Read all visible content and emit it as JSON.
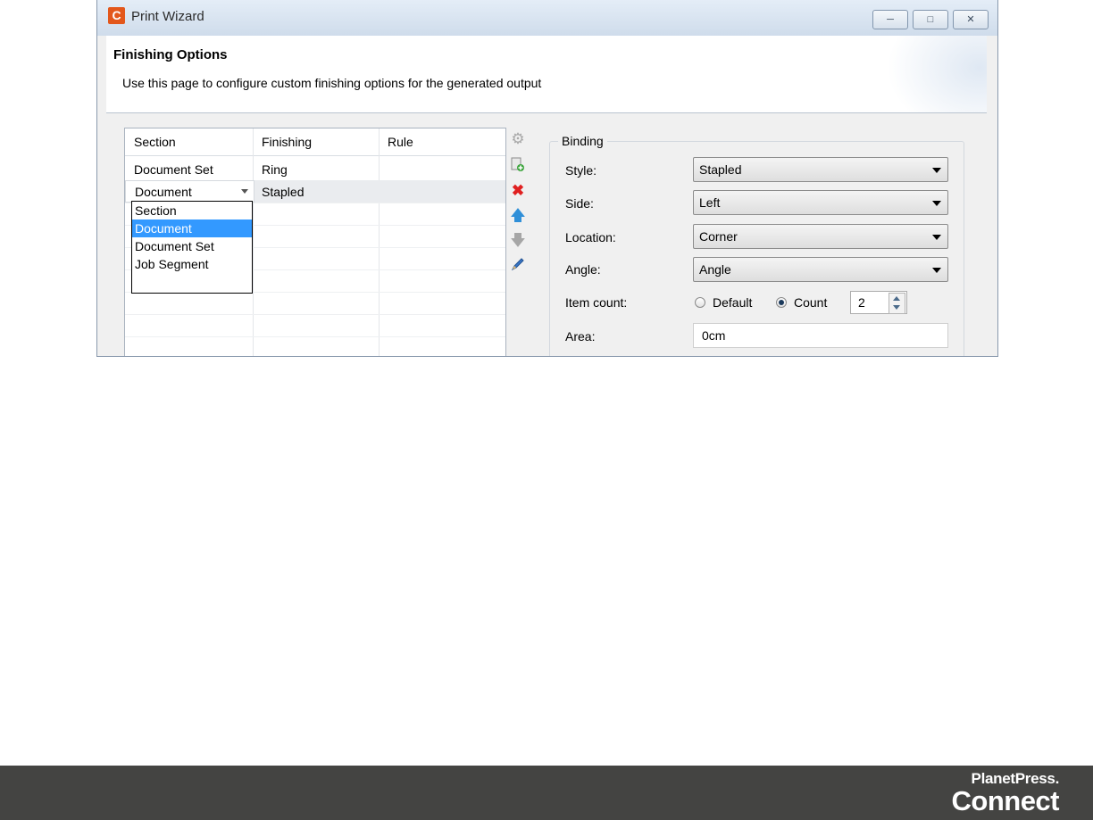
{
  "window": {
    "title": "Print Wizard",
    "app_icon_letter": "C",
    "buttons": {
      "minimize": "minimize",
      "restore": "restore",
      "close": "close"
    }
  },
  "header": {
    "title": "Finishing Options",
    "description": "Use this page to configure custom finishing options for the generated output"
  },
  "table": {
    "columns": [
      "Section",
      "Finishing",
      "Rule"
    ],
    "rows": [
      {
        "section": "Document Set",
        "finishing": "Ring",
        "rule": ""
      },
      {
        "section": "Document",
        "finishing": "Stapled",
        "rule": ""
      }
    ],
    "dropdown_options": [
      "Section",
      "Document",
      "Document Set",
      "Job Segment"
    ],
    "dropdown_selected": "Document"
  },
  "toolbar": {
    "icons": [
      "settings-icon",
      "add-icon",
      "delete-icon",
      "move-up-icon",
      "move-down-icon",
      "edit-icon"
    ]
  },
  "binding": {
    "group_label": "Binding",
    "style": {
      "label": "Style:",
      "value": "Stapled"
    },
    "side": {
      "label": "Side:",
      "value": "Left"
    },
    "location": {
      "label": "Location:",
      "value": "Corner"
    },
    "angle": {
      "label": "Angle:",
      "value": "Angle"
    },
    "item_count": {
      "label": "Item count:",
      "default_label": "Default",
      "count_label": "Count",
      "selected": "Count",
      "count_value": "2"
    },
    "area": {
      "label": "Area:",
      "value": "0cm"
    }
  },
  "footer": {
    "brand_line1": "PlanetPress.",
    "brand_line2": "Connect"
  },
  "colors": {
    "footer_bg": "#444442",
    "selection": "#3399ff",
    "app_icon": "#e3571b"
  }
}
